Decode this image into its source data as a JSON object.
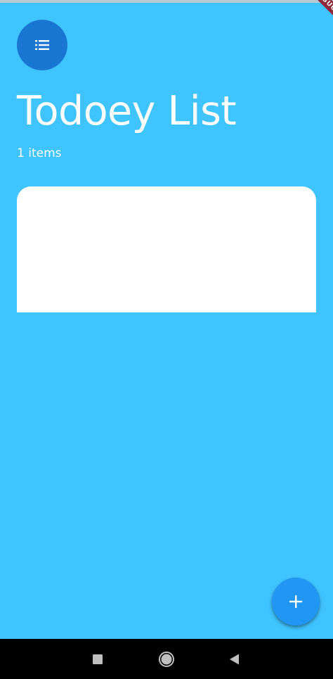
{
  "app": {
    "title": "Todoey List",
    "item_count_label": "1 items",
    "debug_banner": "DEBUG"
  },
  "icons": {
    "header_icon": "list-icon",
    "fab_icon": "plus-icon",
    "nav_recent": "square-icon",
    "nav_home": "circle-icon",
    "nav_back": "triangle-back-icon"
  },
  "colors": {
    "background": "#40c4ff",
    "avatar": "#1976d2",
    "fab": "#2196f3",
    "sheet": "#ffffff",
    "debug_banner": "#8b2a3b"
  }
}
